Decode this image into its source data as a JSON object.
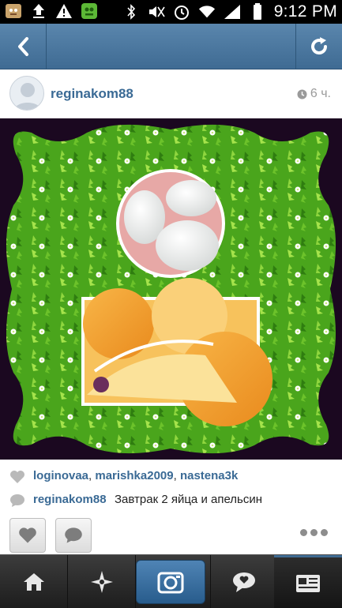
{
  "status_bar": {
    "time": "9:12 PM",
    "left_icons": [
      "cat-app-icon",
      "upload-icon",
      "warning-icon",
      "game-app-icon"
    ],
    "right_icons": [
      "bluetooth-icon",
      "mute-icon",
      "alarm-icon",
      "wifi-icon",
      "signal-icon",
      "battery-icon"
    ]
  },
  "nav": {
    "back_icon": "chevron-left-icon",
    "refresh_icon": "refresh-icon"
  },
  "post": {
    "username": "reginakom88",
    "time_ago": "6 ч.",
    "likes": [
      "loginovaa",
      "marishka2009",
      "nastena3k"
    ],
    "likes_sep1": ", ",
    "likes_sep2": ", ",
    "comment_user": "reginakom88",
    "comment_text": "Завтрак 2 яйца и апельсин"
  },
  "colors": {
    "accent": "#3a6a95",
    "navbar": "#4a77a0",
    "photo_bg": "#1b0820",
    "frame_green": "#4fae1f"
  }
}
